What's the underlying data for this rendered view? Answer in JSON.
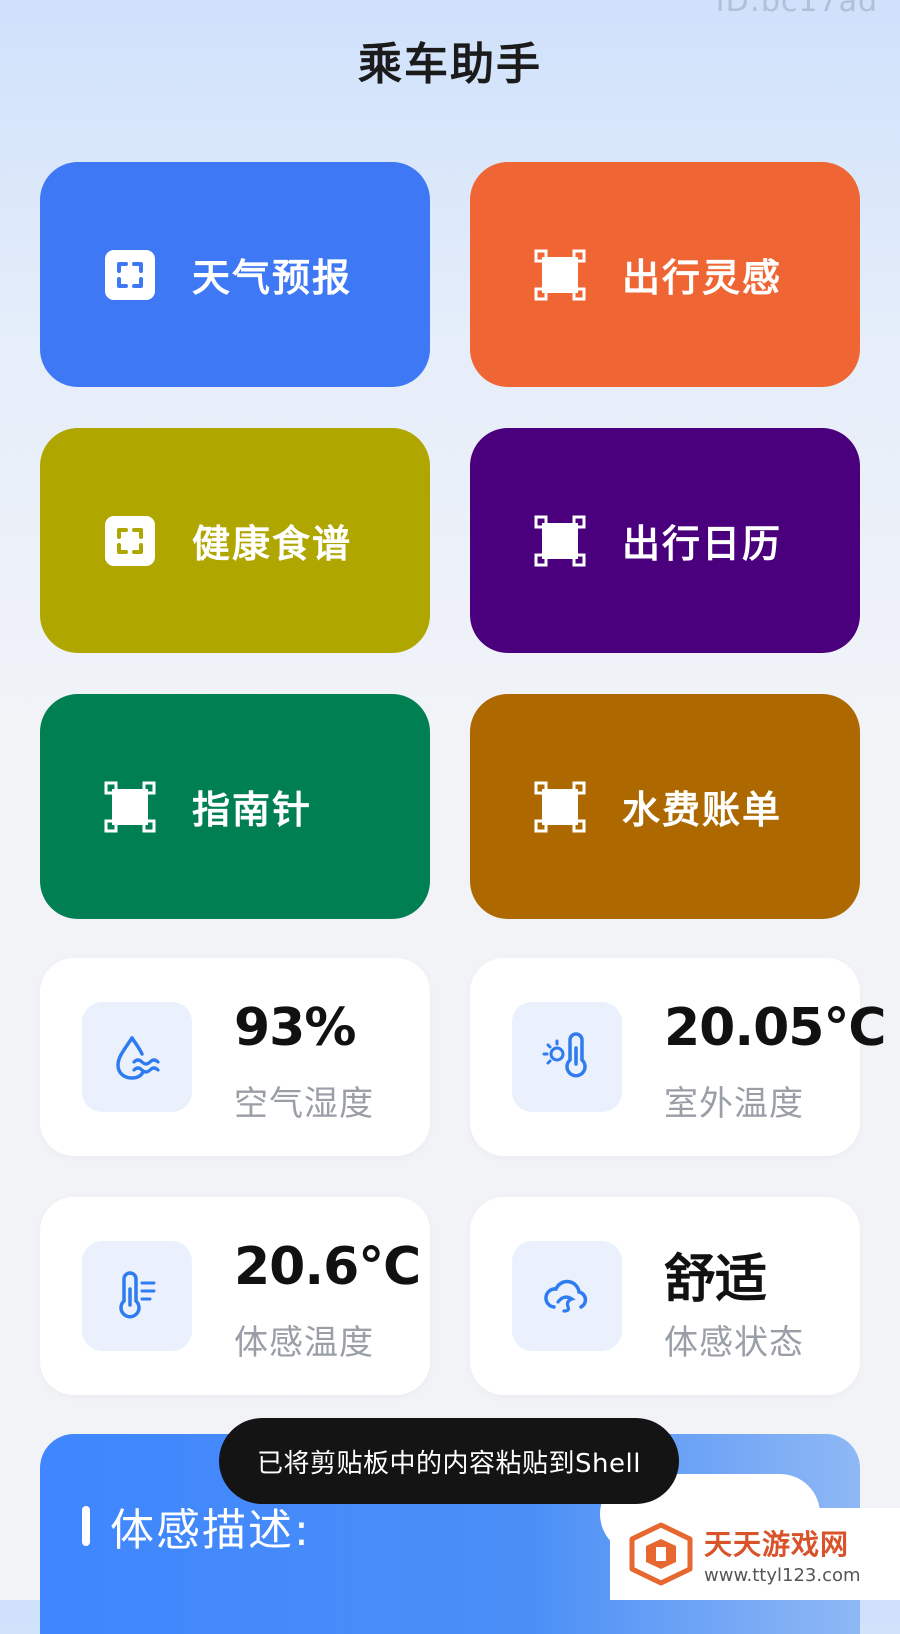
{
  "header": {
    "id_watermark": "ID:bc17ad",
    "title": "乘车助手"
  },
  "tiles": [
    {
      "label": "天气预报",
      "color": "#3e78f5",
      "icon": "scan-frame-icon"
    },
    {
      "label": "出行灵感",
      "color": "#ef6634",
      "icon": "square-select-icon"
    },
    {
      "label": "健康食谱",
      "color": "#b0a600",
      "icon": "scan-frame-icon"
    },
    {
      "label": "出行日历",
      "color": "#4a007c",
      "icon": "square-select-icon"
    },
    {
      "label": "指南针",
      "color": "#007f52",
      "icon": "square-select-icon"
    },
    {
      "label": "水费账单",
      "color": "#ad6800",
      "icon": "square-select-icon"
    }
  ],
  "stats": [
    {
      "value": "93%",
      "label": "空气湿度",
      "icon": "humidity-icon"
    },
    {
      "value": "20.05℃",
      "label": "室外温度",
      "icon": "sun-thermometer-icon"
    },
    {
      "value": "20.6℃",
      "label": "体感温度",
      "icon": "thermometer-icon"
    },
    {
      "value": "舒适",
      "label": "体感状态",
      "icon": "cloud-wind-icon"
    }
  ],
  "description": {
    "title": "体感描述:"
  },
  "toast": {
    "text": "已将剪贴板中的内容粘贴到Shell"
  },
  "branding": {
    "name": "天天游戏网",
    "url": "www.ttyl123.com"
  },
  "colors": {
    "accent": "#3f86ff",
    "icon_blue": "#2f7bf0"
  }
}
